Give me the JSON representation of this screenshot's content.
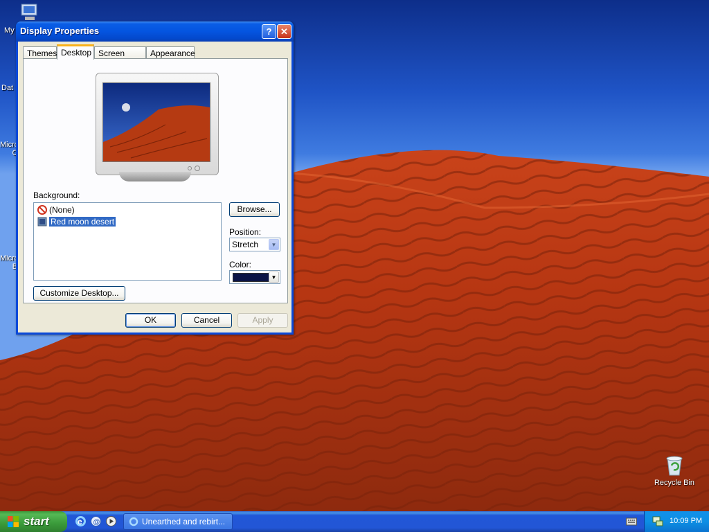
{
  "desktop": {
    "icons": [
      {
        "name": "My",
        "id": "my-computer"
      },
      {
        "name": "Dat",
        "id": "data"
      },
      {
        "name": "Micro",
        "id": "micro-1",
        "line2": "C"
      },
      {
        "name": "Micro",
        "id": "micro-2",
        "line2": "B"
      },
      {
        "name": "Recycle Bin",
        "id": "recycle-bin"
      }
    ]
  },
  "dialog": {
    "title": "Display Properties",
    "help_glyph": "?",
    "close_glyph": "✕",
    "tabs": [
      {
        "label": "Themes",
        "active": false
      },
      {
        "label": "Desktop",
        "active": true
      },
      {
        "label": "Screen Saver",
        "active": false
      },
      {
        "label": "Appearance",
        "active": false
      }
    ],
    "background_label": "Background:",
    "background_items": [
      {
        "label": "(None)",
        "selected": false,
        "icon": "none-icon"
      },
      {
        "label": "Red moon desert",
        "selected": true,
        "icon": "image-file-icon"
      }
    ],
    "browse_label": "Browse...",
    "position_label": "Position:",
    "position_value": "Stretch",
    "color_label": "Color:",
    "color_value": "#0b1446",
    "customize_label": "Customize Desktop...",
    "ok_label": "OK",
    "cancel_label": "Cancel",
    "apply_label": "Apply"
  },
  "taskbar": {
    "start_label": "start",
    "task_item": "Unearthed and rebirt...",
    "clock": "10:09 PM"
  }
}
